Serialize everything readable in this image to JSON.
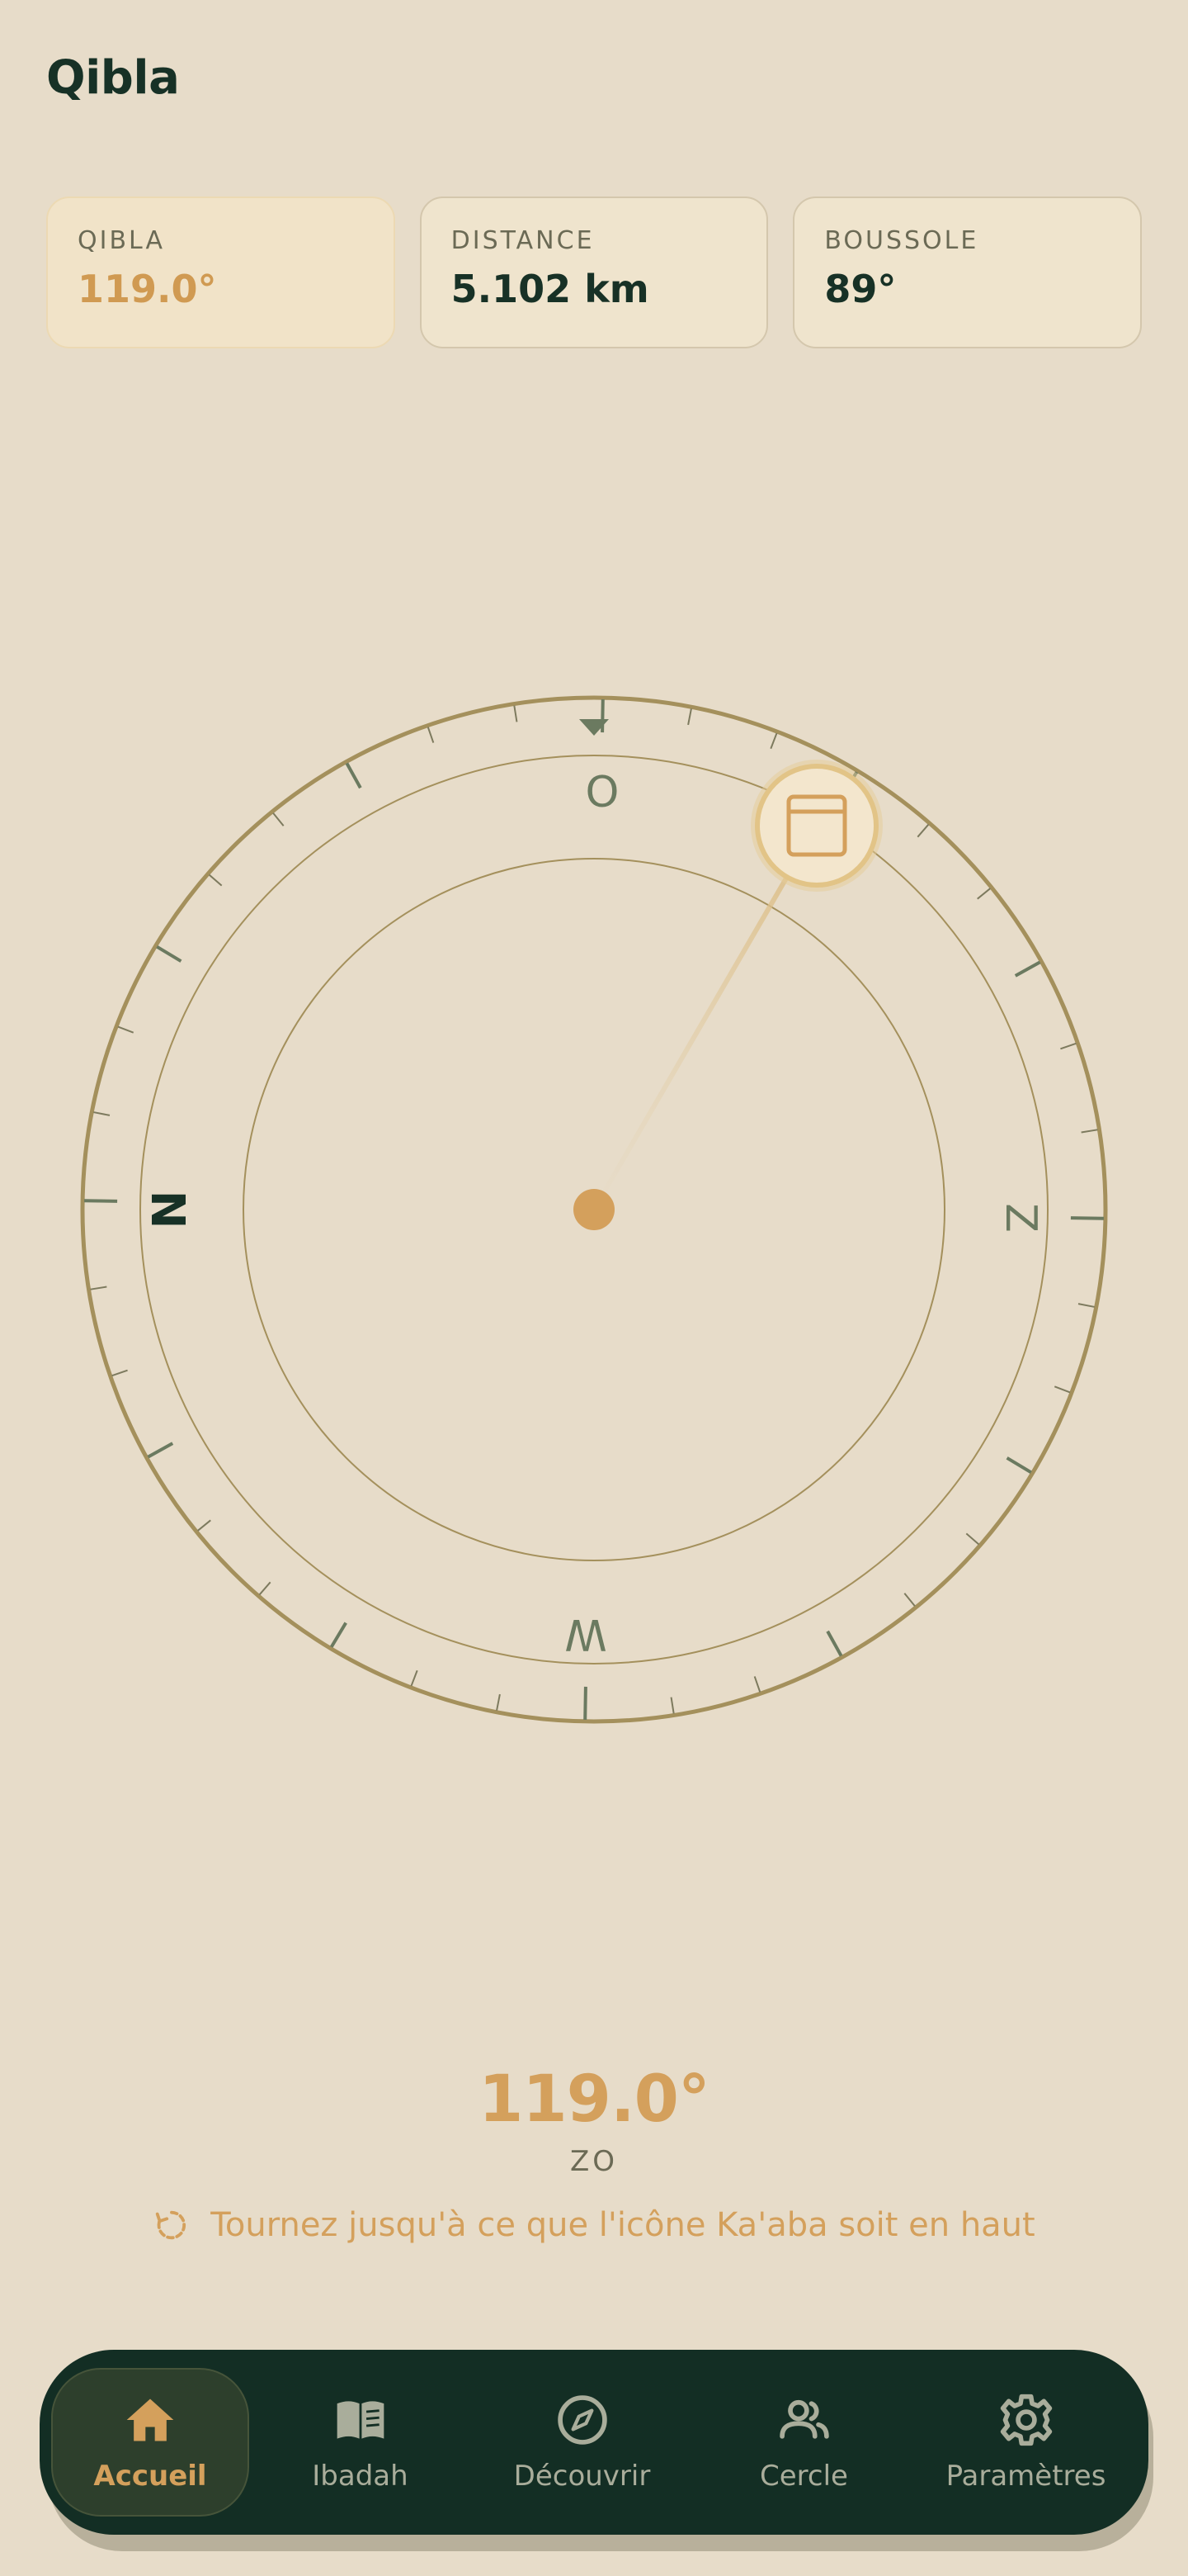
{
  "header": {
    "title": "Qibla"
  },
  "stats": [
    {
      "label": "QIBLA",
      "value": "119.0°"
    },
    {
      "label": "DISTANCE",
      "value": "5.102 km"
    },
    {
      "label": "BOUSSOLE",
      "value": "89°"
    }
  ],
  "compass": {
    "cardinals": {
      "top": "O",
      "right": "Z",
      "bottom": "W",
      "left": "N"
    },
    "heading_deg": 89,
    "qibla_deg": 119.0
  },
  "readout": {
    "angle": "119.0°",
    "direction": "ZO",
    "hint": "Tournez jusqu'à ce que l'icône Ka'aba soit en haut"
  },
  "nav": {
    "items": [
      {
        "label": "Accueil",
        "icon": "home-icon",
        "active": true
      },
      {
        "label": "Ibadah",
        "icon": "book-icon",
        "active": false
      },
      {
        "label": "Découvrir",
        "icon": "compass-icon",
        "active": false
      },
      {
        "label": "Cercle",
        "icon": "people-icon",
        "active": false
      },
      {
        "label": "Paramètres",
        "icon": "gear-icon",
        "active": false
      }
    ]
  },
  "colors": {
    "background": "#e7dcc9",
    "accent": "#d4a05c",
    "dark": "#132e24",
    "ring": "#a4905c"
  }
}
